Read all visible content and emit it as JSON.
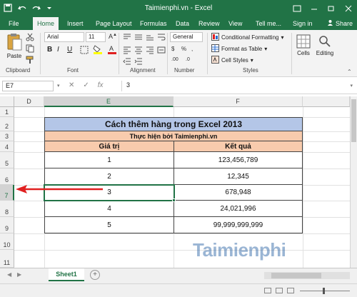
{
  "window": {
    "title": "Taimienphi.vn - Excel",
    "controls": [
      "ribbon-display-icon",
      "minimize-icon",
      "restore-icon",
      "close-icon"
    ]
  },
  "tabs": [
    {
      "label": "File"
    },
    {
      "label": "Home"
    },
    {
      "label": "Insert"
    },
    {
      "label": "Page Layout"
    },
    {
      "label": "Formulas"
    },
    {
      "label": "Data"
    },
    {
      "label": "Review"
    },
    {
      "label": "View"
    },
    {
      "label": "Tell me..."
    },
    {
      "label": "Sign in"
    },
    {
      "label": "Share"
    }
  ],
  "ribbon": {
    "clipboard": {
      "paste_label": "Paste",
      "group_label": "Clipboard"
    },
    "font": {
      "family": "Arial",
      "size": "11",
      "group_label": "Font"
    },
    "alignment": {
      "group_label": "Alignment"
    },
    "number": {
      "format": "General",
      "group_label": "Number"
    },
    "styles": {
      "conditional": "Conditional Formatting",
      "format_table": "Format as Table",
      "cell_styles": "Cell Styles",
      "group_label": "Styles"
    },
    "cells_label": "Cells",
    "editing_label": "Editing"
  },
  "formula_bar": {
    "name_box": "E7",
    "value": "3"
  },
  "columns": [
    "D",
    "E",
    "F"
  ],
  "rows": [
    "1",
    "2",
    "3",
    "4",
    "5",
    "6",
    "7",
    "8",
    "9",
    "10",
    "11"
  ],
  "table": {
    "title": "Cách thêm hàng trong Excel 2013",
    "subtitle": "Thực hiện bởi Taimienphi.vn",
    "headers": [
      "Giá trị",
      "Kết quả"
    ],
    "rows": [
      [
        "1",
        "123,456,789"
      ],
      [
        "2",
        "12,345"
      ],
      [
        "3",
        "678,948"
      ],
      [
        "4",
        "24,021,996"
      ],
      [
        "5",
        "99,999,999,999"
      ]
    ]
  },
  "sheet": {
    "name": "Sheet1"
  },
  "watermark": "Taimienphi",
  "colors": {
    "excel_green": "#217346",
    "title_fill": "#b4c6e7",
    "header_fill": "#f8cbad",
    "arrow": "#e02020"
  }
}
